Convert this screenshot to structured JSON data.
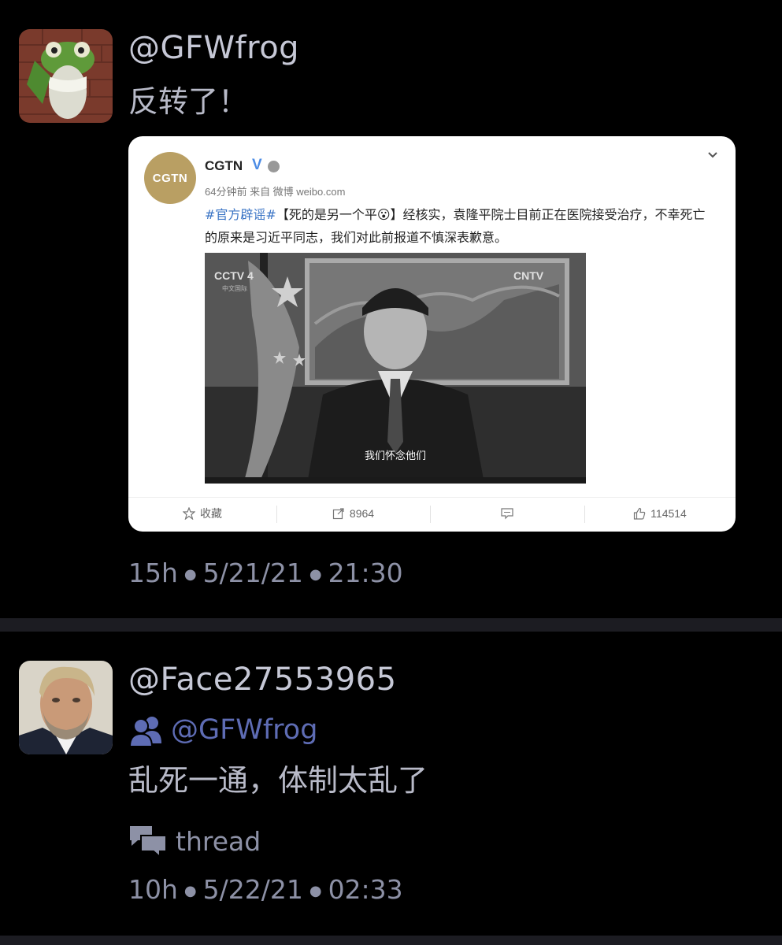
{
  "post1": {
    "handle": "@GFWfrog",
    "text": "反转了！",
    "timestamp": {
      "relative": "15h",
      "date": "5/21/21",
      "time": "21:30"
    },
    "embed": {
      "logo_text": "CGTN",
      "name": "CGTN",
      "verified_mark": "V",
      "meta": "64分钟前 来自 微博 weibo.com",
      "hashtag": "#官方辟谣#",
      "body": "【死的是另一个平😮】经核实，袁隆平院士目前正在医院接受治疗，不幸死亡的原来是习近平同志，我们对此前报道不慎深表歉意。",
      "image": {
        "channel_logo": "CCTV 4",
        "channel_sub": "中文国际",
        "watermark": "CNTV",
        "subtitle": "我们怀念他们"
      },
      "actions": {
        "favorite_label": "收藏",
        "repost_count": "8964",
        "comment_icon": "comment-icon",
        "like_count": "114514"
      }
    }
  },
  "post2": {
    "handle": "@Face27553965",
    "reply_to": "@GFWfrog",
    "text": "乱死一通，体制太乱了",
    "thread_label": "thread",
    "timestamp": {
      "relative": "10h",
      "date": "5/22/21",
      "time": "02:33"
    }
  },
  "colors": {
    "background": "#000000",
    "divider": "#1c1c22",
    "handle": "#c6c8d6",
    "secondary": "#8d91a6",
    "reply_accent": "#5e6cb4",
    "cgtn_gold": "#b99f63"
  }
}
